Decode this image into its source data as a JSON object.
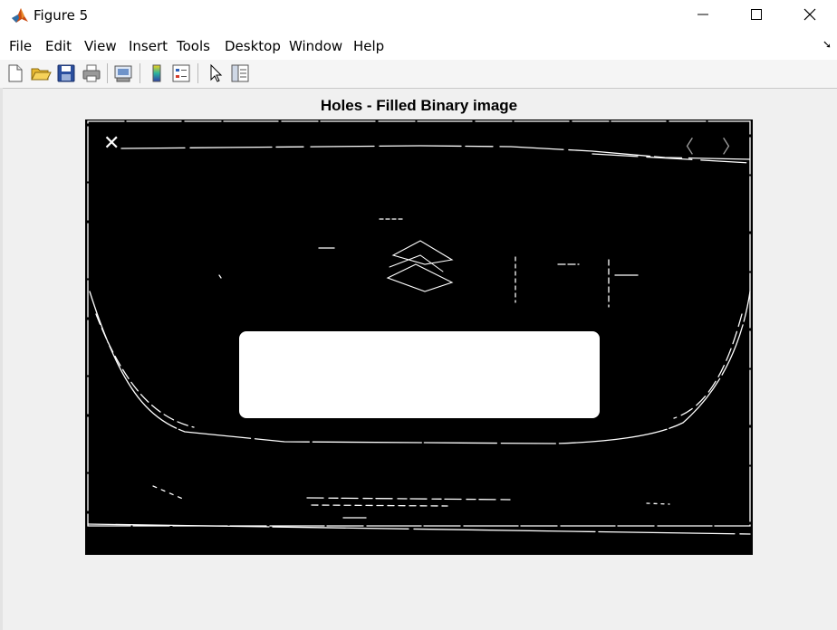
{
  "window": {
    "title": "Figure 5",
    "controls": [
      "minimize",
      "maximize",
      "close"
    ]
  },
  "menu": {
    "items": [
      "File",
      "Edit",
      "View",
      "Insert",
      "Tools",
      "Desktop",
      "Window",
      "Help"
    ]
  },
  "toolbar": {
    "icons": [
      "new-figure-icon",
      "open-file-icon",
      "save-icon",
      "print-icon",
      "print-preview-icon",
      "colorbar-icon",
      "legend-icon",
      "pointer-icon",
      "property-editor-icon"
    ]
  },
  "axes": {
    "title": "Holes - Filled Binary image"
  },
  "image_overlay": {
    "close_glyph": "✕",
    "prev_glyph": "〈",
    "next_glyph": "〉"
  },
  "colors": {
    "image_background": "#000000",
    "foreground": "#ffffff",
    "figure_background": "#f0f0f0"
  }
}
